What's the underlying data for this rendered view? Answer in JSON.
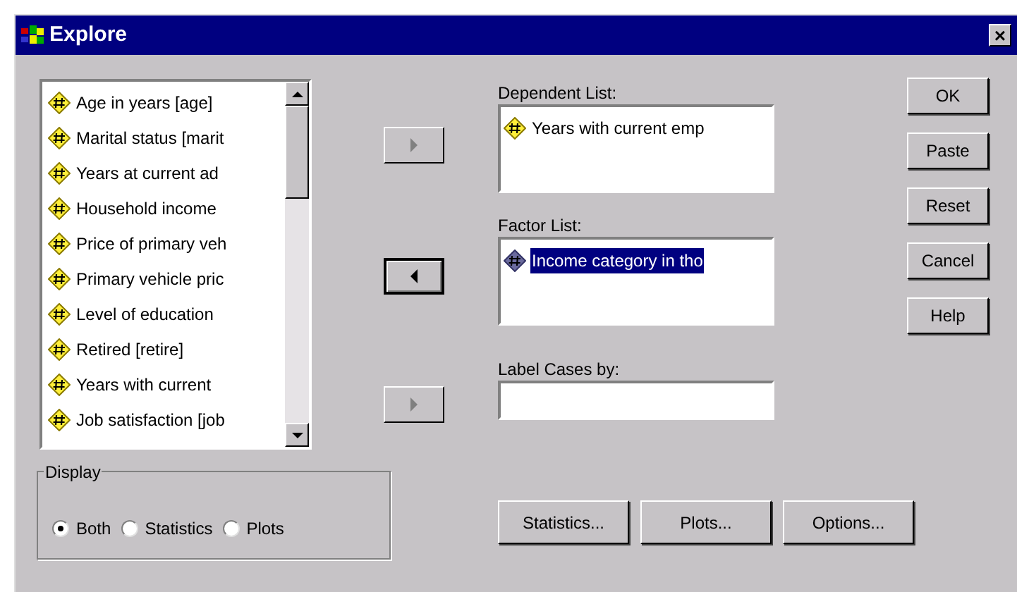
{
  "window": {
    "title": "Explore",
    "close": "×"
  },
  "variables": [
    {
      "label": "Age in years [age]",
      "selected": false
    },
    {
      "label": "Marital status [marit",
      "selected": false
    },
    {
      "label": "Years at current ad",
      "selected": false
    },
    {
      "label": "Household income",
      "selected": false
    },
    {
      "label": "Price of primary veh",
      "selected": false
    },
    {
      "label": "Primary vehicle pric",
      "selected": false
    },
    {
      "label": "Level of education",
      "selected": false
    },
    {
      "label": "Retired [retire]",
      "selected": false
    },
    {
      "label": "Years with current",
      "selected": false
    },
    {
      "label": "Job satisfaction [job",
      "selected": false
    }
  ],
  "arrows": [
    {
      "kind": "right",
      "disabled": true
    },
    {
      "kind": "left",
      "disabled": false
    },
    {
      "kind": "right",
      "disabled": true
    }
  ],
  "dependent_list": {
    "label": "Dependent List:",
    "items": [
      {
        "label": "Years with current emp",
        "selected": false
      }
    ]
  },
  "factor_list": {
    "label": "Factor List:",
    "items": [
      {
        "label": "Income category in tho",
        "selected": true
      }
    ]
  },
  "label_cases": {
    "label": "Label Cases by:"
  },
  "side_buttons": [
    "OK",
    "Paste",
    "Reset",
    "Cancel",
    "Help"
  ],
  "display": {
    "title": "Display",
    "options": [
      {
        "label": "Both",
        "selected": true
      },
      {
        "label": "Statistics",
        "selected": false
      },
      {
        "label": "Plots",
        "selected": false
      }
    ]
  },
  "bottom_buttons": [
    "Statistics...",
    "Plots...",
    "Options..."
  ]
}
